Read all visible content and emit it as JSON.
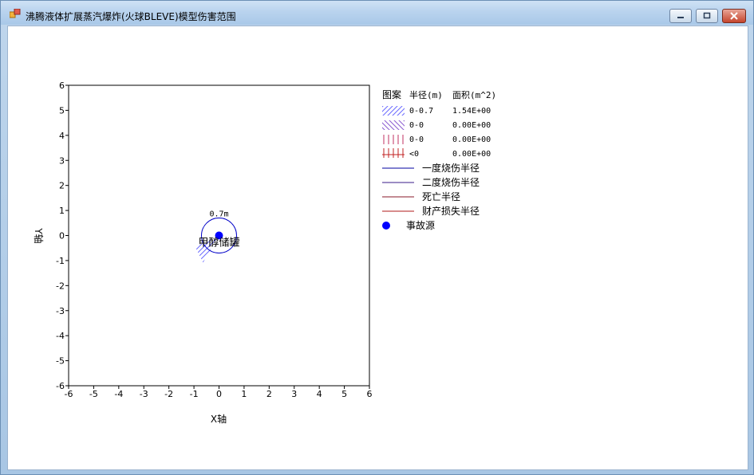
{
  "window": {
    "title": "沸腾液体扩展蒸汽爆炸(火球BLEVE)模型伤害范围",
    "buttons": {
      "minimize": "minimize",
      "maximize": "maximize",
      "close": "close"
    }
  },
  "plot": {
    "x_axis_label": "X轴",
    "y_axis_label": "Y轴",
    "x_ticks": [
      "-6",
      "-5",
      "-4",
      "-3",
      "-2",
      "-1",
      "0",
      "1",
      "2",
      "3",
      "4",
      "5",
      "6"
    ],
    "y_ticks": [
      "6",
      "5",
      "4",
      "3",
      "2",
      "1",
      "0",
      "-1",
      "-2",
      "-3",
      "-4",
      "-5",
      "-6"
    ],
    "xlim": [
      -6,
      6
    ],
    "ylim": [
      -6,
      6
    ],
    "circle_label": "0.7m",
    "circle_radius": 0.7,
    "source_label": "甲醇储罐",
    "source_point": [
      0,
      0
    ],
    "colors": {
      "circle": "#0000c8",
      "hatch": "#6a6aff",
      "source": "#0000ff"
    }
  },
  "legend": {
    "headers": {
      "pattern": "图案",
      "radius": "半径(m)",
      "area": "面积(m^2)"
    },
    "rows": [
      {
        "radius": "0-0.7",
        "area": "1.54E+00",
        "pattern": "diagonal-blue"
      },
      {
        "radius": "0-0",
        "area": "0.00E+00",
        "pattern": "backdiagonal-purple"
      },
      {
        "radius": "0-0",
        "area": "0.00E+00",
        "pattern": "vertical-red"
      },
      {
        "radius": "<0",
        "area": "0.00E+00",
        "pattern": "cross-red"
      }
    ],
    "lines": [
      {
        "label": "一度烧伤半径",
        "color": "#0000a0"
      },
      {
        "label": "二度烧伤半径",
        "color": "#3a1a8a"
      },
      {
        "label": "死亡半径",
        "color": "#8a1a2a"
      },
      {
        "label": "财产损失半径",
        "color": "#b01818"
      }
    ],
    "source_label": "事故源"
  }
}
